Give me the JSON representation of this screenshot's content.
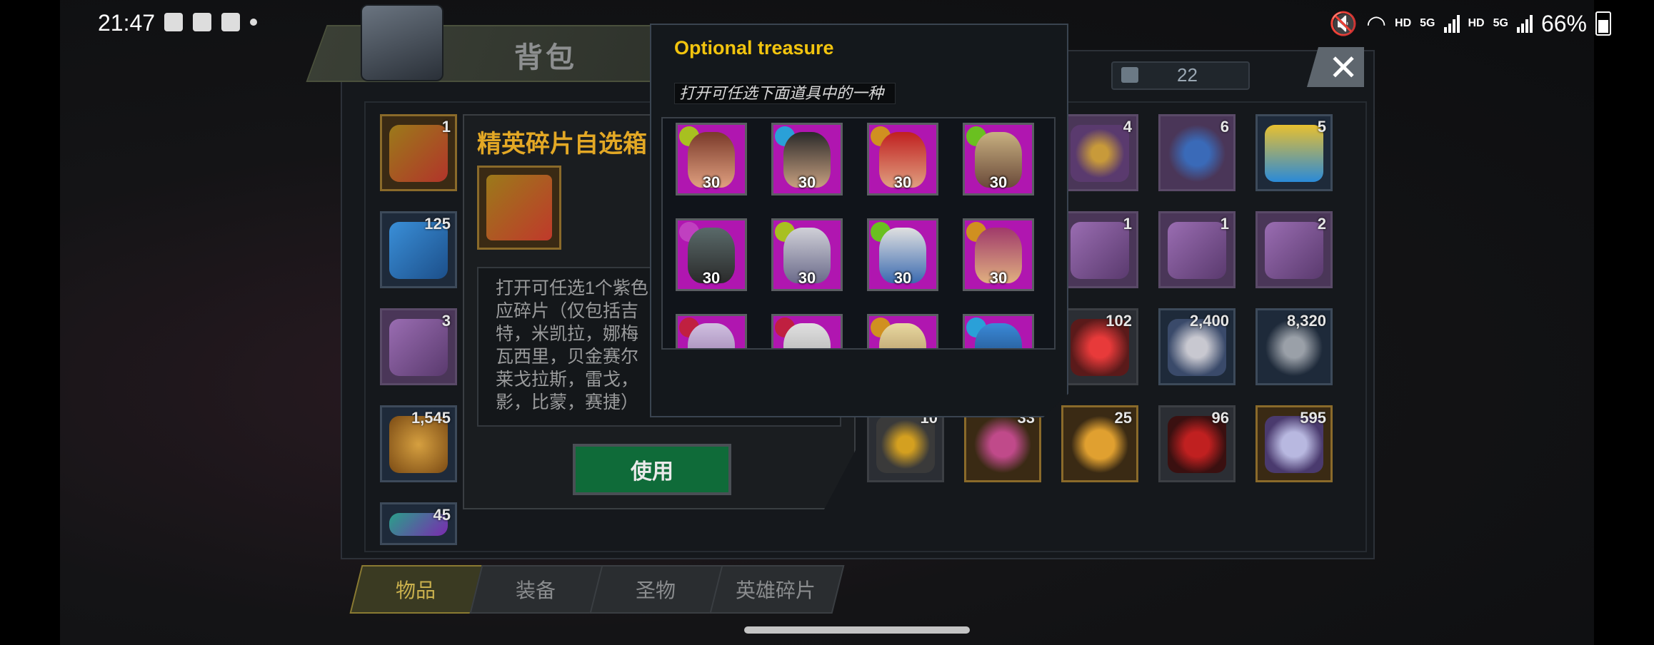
{
  "status_bar": {
    "time": "21:47",
    "battery": "66%",
    "hd1": "HD",
    "hd2": "HD",
    "net1": "5G",
    "net2": "5G"
  },
  "header": {
    "title": "背包",
    "currency_value": "22",
    "close_label": "✕"
  },
  "detail": {
    "title": "精英碎片自选箱",
    "description_lines": [
      "打开可任选1个紫色",
      "应碎片（仅包括吉",
      "特，米凯拉，娜梅",
      "瓦西里，贝金赛尔",
      "莱戈拉斯，雷戈，",
      "影，比蒙，赛捷）"
    ],
    "use_label": "使用"
  },
  "popup": {
    "title": "Optional treasure",
    "subtitle": "打开可任选下面道具中的一种",
    "heroes": [
      {
        "count": "30"
      },
      {
        "count": "30"
      },
      {
        "count": "30"
      },
      {
        "count": "30"
      },
      {
        "count": "30"
      },
      {
        "count": "30"
      },
      {
        "count": "30"
      },
      {
        "count": "30"
      },
      {
        "count": ""
      },
      {
        "count": ""
      },
      {
        "count": ""
      },
      {
        "count": ""
      }
    ]
  },
  "left_items": [
    {
      "count": "1",
      "icon": "treasure-chest-icon"
    },
    {
      "count": "125",
      "icon": "cinema-ticket-icon"
    },
    {
      "count": "3",
      "icon": "tshirt-icon"
    },
    {
      "count": "1,545",
      "icon": "fist-icon"
    },
    {
      "count": "45",
      "icon": "dna-icon"
    }
  ],
  "right_items": [
    {
      "count": "4",
      "icon": "chip-icon"
    },
    {
      "count": "6",
      "icon": "police-badge-icon"
    },
    {
      "count": "5",
      "icon": "cocktail-icon"
    },
    {
      "count": "1",
      "icon": "revolver-icon"
    },
    {
      "count": "1",
      "icon": "boot-icon"
    },
    {
      "count": "2",
      "icon": "cowboy-hat-icon"
    },
    {
      "count": "102",
      "icon": "red-core-icon"
    },
    {
      "count": "2,400",
      "icon": "helmet-icon"
    },
    {
      "count": "8,320",
      "icon": "crystal-icon"
    },
    {
      "count": "10",
      "icon": "lightning-icon"
    },
    {
      "count": "33",
      "icon": "gem-icon"
    },
    {
      "count": "25",
      "icon": "gold-coins-icon"
    },
    {
      "count": "96",
      "icon": "red-target-icon"
    },
    {
      "count": "595",
      "icon": "silver-medal-icon"
    }
  ],
  "tabs": [
    {
      "label": "物品",
      "active": true
    },
    {
      "label": "装备",
      "active": false
    },
    {
      "label": "圣物",
      "active": false
    },
    {
      "label": "英雄碎片",
      "active": false
    }
  ]
}
